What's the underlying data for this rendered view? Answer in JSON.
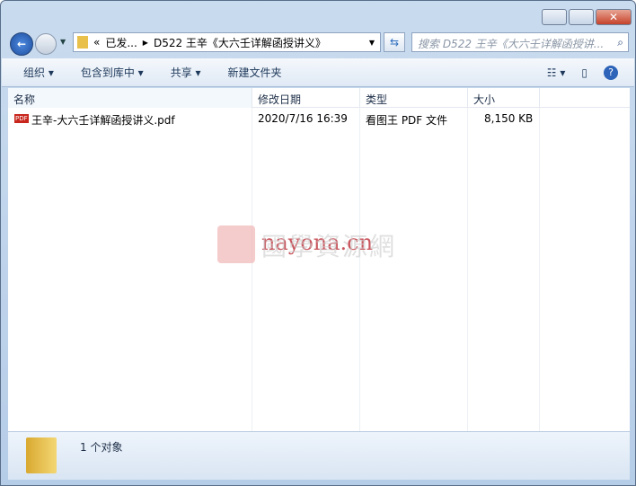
{
  "window": {
    "controls": [
      "minimize",
      "maximize",
      "close"
    ]
  },
  "address": {
    "prefix": "«",
    "crumb1": "已发...",
    "crumb2": "D522 王辛《大六壬详解函授讲义》"
  },
  "search": {
    "placeholder": "搜索 D522 王辛《大六壬详解函授讲..."
  },
  "toolbar": {
    "organize": "组织 ▾",
    "include": "包含到库中 ▾",
    "share": "共享 ▾",
    "new_folder": "新建文件夹"
  },
  "columns": [
    "名称",
    "修改日期",
    "类型",
    "大小"
  ],
  "files": [
    {
      "name": "王辛-大六壬详解函授讲义.pdf",
      "date": "2020/7/16 16:39",
      "type": "看图王 PDF 文件",
      "size": "8,150 KB",
      "icon": "PDF"
    }
  ],
  "watermark": {
    "text": "nayona.cn",
    "chars": "國學資源網"
  },
  "status": {
    "count": "1 个对象"
  }
}
